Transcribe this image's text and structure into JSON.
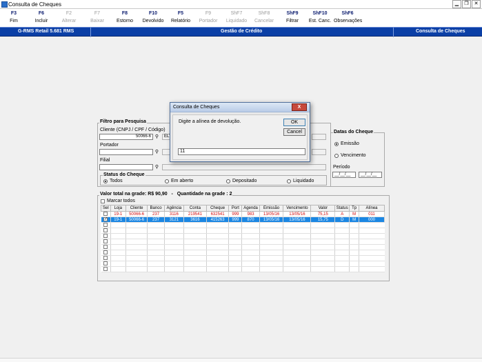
{
  "window": {
    "title": "Consulta de Cheques"
  },
  "toolbar": [
    {
      "key": "F3",
      "label": "Fim",
      "enabled": true
    },
    {
      "key": "F6",
      "label": "Incluir",
      "enabled": true
    },
    {
      "key": "F2",
      "label": "Alterar",
      "enabled": false
    },
    {
      "key": "F7",
      "label": "Baixar",
      "enabled": false
    },
    {
      "key": "F8",
      "label": "Estorno",
      "enabled": true
    },
    {
      "key": "F10",
      "label": "Devolvido",
      "enabled": true
    },
    {
      "key": "F5",
      "label": "Relatório",
      "enabled": true
    },
    {
      "key": "F9",
      "label": "Portador",
      "enabled": false
    },
    {
      "key": "ShF7",
      "label": "Liquidado",
      "enabled": false
    },
    {
      "key": "ShF8",
      "label": "Cancelar",
      "enabled": false
    },
    {
      "key": "ShF9",
      "label": "Filtrar",
      "enabled": true
    },
    {
      "key": "ShF10",
      "label": "Est. Canc.",
      "enabled": true
    },
    {
      "key": "ShF6",
      "label": "Observações",
      "enabled": true
    }
  ],
  "header": {
    "left": "G-RMS Retail 5.681 RMS",
    "center": "Gestão de Crédito",
    "right": "Consulta de Cheques"
  },
  "filter": {
    "group_title": "Filtro para Pesquisa",
    "cliente_label": "Cliente (CNPJ / CPF / Código)",
    "cliente_value": "50066-6",
    "cliente_desc": "ELT",
    "portador_label": "Portador",
    "filial_label": "Filial",
    "status_title": "Status do Cheque",
    "status_options": [
      "Todos",
      "Em aberto",
      "Depositado",
      "Liquidado"
    ],
    "status_selected": "Todos"
  },
  "datas": {
    "title": "Datas do Cheque",
    "options": [
      "Emissão",
      "Vencimento"
    ],
    "selected": "Emissão",
    "periodo_label": "Período",
    "date_from": "__/__/__",
    "date_to": "__/__/__"
  },
  "summary": {
    "valor_label": "Valor total na grade:",
    "valor_value": "R$ 90,90",
    "separator": "-",
    "quantidade_label": "Quantidade na grade :",
    "quantidade_value": "2",
    "marcar_todos": "Marcar todos"
  },
  "grid": {
    "columns": [
      "Sel",
      "Loja",
      "Cliente",
      "Banco",
      "Agência",
      "Conta",
      "Cheque",
      "Port",
      "Agenda",
      "Emissão",
      "Vencimento",
      "Valor",
      "Status",
      "Tp",
      "Alínea"
    ],
    "rows": [
      {
        "checked": false,
        "style": "red",
        "cells": [
          "19-1",
          "50066-6",
          "237",
          "3116",
          "219541",
          "632541",
          "999",
          "983",
          "13/05/16",
          "13/05/16",
          "75,15",
          "A",
          "M",
          "011"
        ]
      },
      {
        "checked": true,
        "style": "selected",
        "cells": [
          "19-1",
          "50066-6",
          "237",
          "3121",
          "3616",
          "415263",
          "999",
          "870",
          "13/05/16",
          "13/05/16",
          "15,75",
          "D",
          "M",
          "000"
        ]
      }
    ],
    "empty_rows": 9
  },
  "dialog": {
    "title": "Consulta de Cheques",
    "close": "X",
    "prompt": "Digite a alínea de devolução.",
    "ok": "OK",
    "cancel": "Cancel",
    "input_value": "11"
  },
  "colors": {
    "header_blue": "#0b3fa6",
    "selection": "#1c87e3",
    "alert_red": "#d10a0a"
  }
}
